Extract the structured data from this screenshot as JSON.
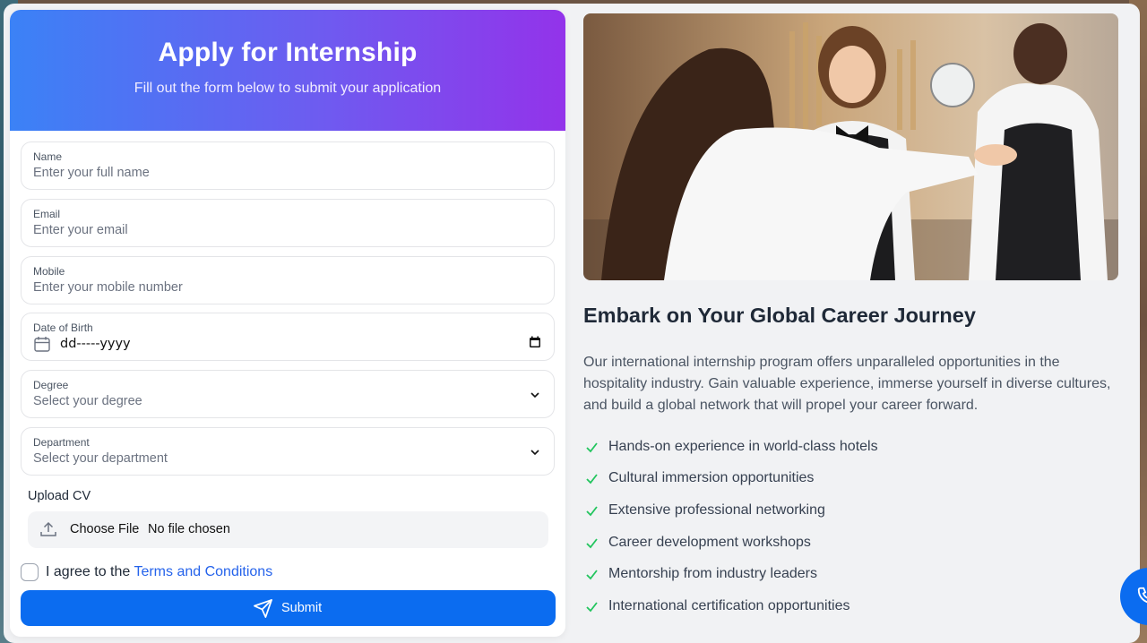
{
  "header": {
    "title": "Apply for Internship",
    "subtitle": "Fill out the form below to submit your application"
  },
  "fields": {
    "name": {
      "label": "Name",
      "placeholder": "Enter your full name"
    },
    "email": {
      "label": "Email",
      "placeholder": "Enter your email"
    },
    "mobile": {
      "label": "Mobile",
      "placeholder": "Enter your mobile number"
    },
    "dob": {
      "label": "Date of Birth",
      "value": "dd-----yyyy"
    },
    "degree": {
      "label": "Degree",
      "placeholder": "Select your degree"
    },
    "department": {
      "label": "Department",
      "placeholder": "Select your department"
    }
  },
  "upload": {
    "label": "Upload CV",
    "button": "Choose File",
    "status": "No file chosen"
  },
  "agree": {
    "text": "I agree to the ",
    "link": "Terms and Conditions"
  },
  "submit": {
    "label": "Submit"
  },
  "info": {
    "title": "Embark on Your Global Career Journey",
    "description": "Our international internship program offers unparalleled opportunities in the hospitality industry. Gain valuable experience, immerse yourself in diverse cultures, and build a global network that will propel your career forward.",
    "features": [
      "Hands-on experience in world-class hotels",
      "Cultural immersion opportunities",
      "Extensive professional networking",
      "Career development workshops",
      "Mentorship from industry leaders",
      "International certification opportunities"
    ]
  },
  "colors": {
    "primary": "#0b6cf0",
    "gradient_start": "#3b82f6",
    "gradient_end": "#9333ea",
    "check": "#22c55e",
    "link": "#2563eb"
  }
}
